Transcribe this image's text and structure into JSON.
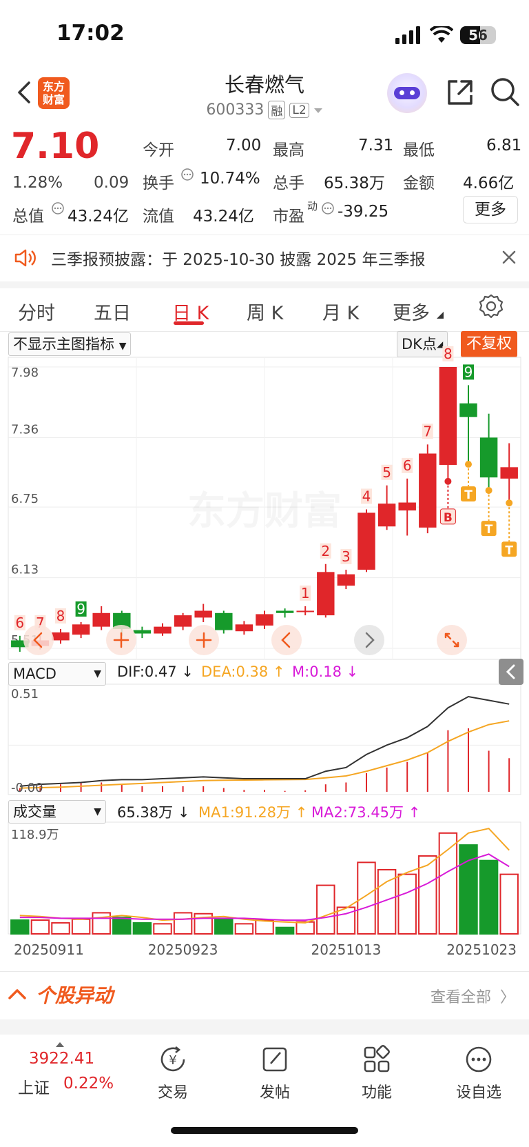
{
  "status": {
    "time": "17:02",
    "battery": "56"
  },
  "header": {
    "logo_line1": "东方",
    "logo_line2": "财富",
    "stock_name": "长春燃气",
    "stock_code": "600333",
    "tag_margin": "融",
    "tag_level": "L2"
  },
  "quote": {
    "price": "7.10",
    "change_pct": "1.28%",
    "change_amt": "0.09",
    "open_label": "今开",
    "open": "7.00",
    "high_label": "最高",
    "high": "7.31",
    "low_label": "最低",
    "low": "6.81",
    "turnover_label": "换手",
    "turnover": "10.74%",
    "volume_label": "总手",
    "volume": "65.38万",
    "amount_label": "金额",
    "amount": "4.66亿",
    "mktcap_label": "总值",
    "mktcap": "43.24亿",
    "float_label": "流值",
    "float_cap": "43.24亿",
    "pe_label": "市盈",
    "pe_sup": "动",
    "pe": "-39.25",
    "more": "更多"
  },
  "notice": {
    "text": "三季报预披露：于 2025-10-30 披露 2025 年三季报"
  },
  "tabs": [
    "分时",
    "五日",
    "日 K",
    "周 K",
    "月 K",
    "更多"
  ],
  "active_tab": "日 K",
  "controls": {
    "main_indicator": "不显示主图指标",
    "dk": "DK点",
    "adjust": "不复权"
  },
  "watermark": "东方财富",
  "macd": {
    "name": "MACD",
    "dif": "DIF:0.47",
    "dea": "DEA:0.38",
    "m": "M:0.18",
    "y_top": "0.51",
    "y_bottom": "-0.00"
  },
  "vol": {
    "name": "成交量",
    "value": "65.38万",
    "ma1": "MA1:91.28万",
    "ma2": "MA2:73.45万",
    "y_top": "118.9万"
  },
  "colors": {
    "up": "#e0262a",
    "down": "#169a2b",
    "brand": "#f05a1e",
    "ma_orange": "#f5a623",
    "ma_magenta": "#d81bd8"
  },
  "movement": {
    "title": "个股异动",
    "view_all": "查看全部"
  },
  "bottom_bar": {
    "index_value": "3922.41",
    "index_name": "上证",
    "index_change": "0.22%",
    "items": [
      "交易",
      "发帖",
      "功能",
      "设自选"
    ]
  },
  "chart_data": {
    "type": "candlestick",
    "ylim": [
      5.51,
      7.98
    ],
    "y_ticks": [
      "7.98",
      "7.36",
      "6.75",
      "6.13",
      "5.51"
    ],
    "x_ticks": [
      "20250911",
      "20250923",
      "20251013",
      "20251023"
    ],
    "candles": [
      {
        "o": 5.58,
        "c": 5.52,
        "h": 5.62,
        "l": 5.48,
        "label": "6"
      },
      {
        "o": 5.53,
        "c": 5.58,
        "h": 5.62,
        "l": 5.5,
        "label": "7"
      },
      {
        "o": 5.58,
        "c": 5.65,
        "h": 5.68,
        "l": 5.55,
        "label": "8"
      },
      {
        "o": 5.63,
        "c": 5.72,
        "h": 5.74,
        "l": 5.6,
        "label": "9"
      },
      {
        "o": 5.7,
        "c": 5.82,
        "h": 5.88,
        "l": 5.67,
        "label": ""
      },
      {
        "o": 5.82,
        "c": 5.68,
        "h": 5.84,
        "l": 5.62,
        "label": ""
      },
      {
        "o": 5.67,
        "c": 5.64,
        "h": 5.7,
        "l": 5.6,
        "label": ""
      },
      {
        "o": 5.64,
        "c": 5.7,
        "h": 5.73,
        "l": 5.62,
        "label": ""
      },
      {
        "o": 5.7,
        "c": 5.8,
        "h": 5.82,
        "l": 5.67,
        "label": ""
      },
      {
        "o": 5.78,
        "c": 5.84,
        "h": 5.9,
        "l": 5.74,
        "label": ""
      },
      {
        "o": 5.82,
        "c": 5.67,
        "h": 5.84,
        "l": 5.64,
        "label": ""
      },
      {
        "o": 5.66,
        "c": 5.72,
        "h": 5.75,
        "l": 5.63,
        "label": ""
      },
      {
        "o": 5.71,
        "c": 5.81,
        "h": 5.84,
        "l": 5.68,
        "label": ""
      },
      {
        "o": 5.84,
        "c": 5.82,
        "h": 5.86,
        "l": 5.78,
        "label": ""
      },
      {
        "o": 5.83,
        "c": 5.84,
        "h": 5.88,
        "l": 5.8,
        "label": "1"
      },
      {
        "o": 5.8,
        "c": 6.18,
        "h": 6.25,
        "l": 5.78,
        "label": "2"
      },
      {
        "o": 6.06,
        "c": 6.16,
        "h": 6.2,
        "l": 6.03,
        "label": "3"
      },
      {
        "o": 6.2,
        "c": 6.7,
        "h": 6.73,
        "l": 6.18,
        "label": "4"
      },
      {
        "o": 6.58,
        "c": 6.78,
        "h": 6.94,
        "l": 6.55,
        "label": "5"
      },
      {
        "o": 6.72,
        "c": 6.79,
        "h": 7.0,
        "l": 6.5,
        "label": "6"
      },
      {
        "o": 6.57,
        "c": 7.22,
        "h": 7.3,
        "l": 6.52,
        "label": "7"
      },
      {
        "o": 7.12,
        "c": 7.98,
        "h": 7.98,
        "l": 7.0,
        "label": "8"
      },
      {
        "o": 7.66,
        "c": 7.54,
        "h": 7.82,
        "l": 7.15,
        "label": "9"
      },
      {
        "o": 7.36,
        "c": 7.01,
        "h": 7.57,
        "l": 6.92,
        "label": ""
      },
      {
        "o": 7.0,
        "c": 7.1,
        "h": 7.31,
        "l": 6.81,
        "label": ""
      }
    ],
    "markers": [
      {
        "index": 21,
        "text": "B"
      },
      {
        "index": 22,
        "text": "T"
      },
      {
        "index": 23,
        "text": "T"
      },
      {
        "index": 24,
        "text": "T"
      }
    ],
    "macd": {
      "dif": [
        0.03,
        0.04,
        0.045,
        0.05,
        0.06,
        0.065,
        0.065,
        0.07,
        0.075,
        0.08,
        0.075,
        0.07,
        0.07,
        0.07,
        0.07,
        0.11,
        0.13,
        0.2,
        0.25,
        0.29,
        0.35,
        0.45,
        0.51,
        0.49,
        0.47
      ],
      "dea": [
        0.02,
        0.022,
        0.025,
        0.03,
        0.035,
        0.04,
        0.045,
        0.05,
        0.055,
        0.06,
        0.062,
        0.063,
        0.064,
        0.065,
        0.066,
        0.075,
        0.085,
        0.11,
        0.14,
        0.17,
        0.21,
        0.27,
        0.32,
        0.36,
        0.38
      ],
      "m": [
        0.02,
        0.03,
        0.04,
        0.05,
        0.05,
        0.04,
        0.03,
        0.03,
        0.03,
        0.03,
        0.02,
        0.01,
        0.01,
        0.005,
        0.008,
        0.04,
        0.05,
        0.1,
        0.13,
        0.16,
        0.21,
        0.33,
        0.34,
        0.22,
        0.18
      ]
    },
    "volume": {
      "values_wan": [
        15,
        15,
        12,
        16,
        23,
        18,
        12,
        11,
        23,
        22,
        17,
        11,
        15,
        7,
        13,
        53,
        29,
        78,
        70,
        65,
        85,
        110,
        97,
        80,
        65
      ],
      "ma1": [
        20,
        19,
        17,
        16,
        18,
        20,
        18,
        15,
        16,
        18,
        19,
        16,
        14,
        13,
        12,
        20,
        28,
        42,
        57,
        67,
        75,
        92,
        110,
        115,
        91.28
      ],
      "ma2": [
        18,
        18,
        17,
        17,
        17,
        17,
        16,
        16,
        16,
        17,
        17,
        17,
        16,
        15,
        15,
        18,
        22,
        29,
        37,
        45,
        55,
        68,
        80,
        87,
        73.45
      ]
    }
  }
}
